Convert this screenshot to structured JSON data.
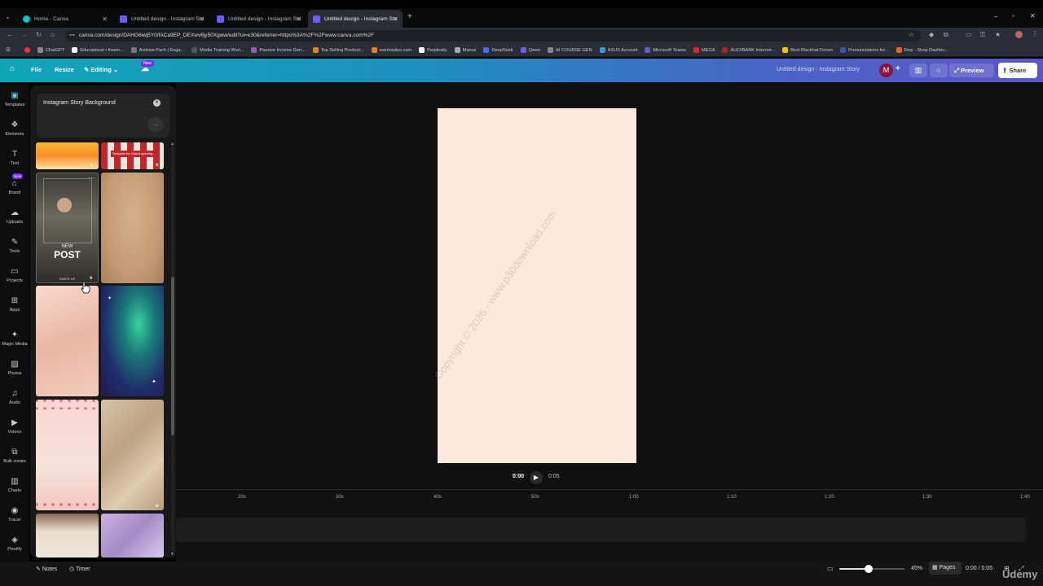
{
  "browser": {
    "tabs": [
      {
        "label": "Home - Canva"
      },
      {
        "label": "Untitled design - Instagram Sto"
      },
      {
        "label": "Untitled design - Instagram Sto"
      },
      {
        "label": "Untitled design - Instagram Sto"
      }
    ],
    "url": "canva.com/design/DAHG6iwj5Y0/fACa9EP_DEXwv6jy50Xgww/edit?ui=e30&referrer=https%3A%2F%2Fwww.canva.com%2F",
    "bookmarks": [
      {
        "label": "ChatGPT",
        "color": "#888888"
      },
      {
        "label": "Educational • freem...",
        "color": "#ffffff"
      },
      {
        "label": "Andrew Pach | Enga...",
        "color": "#777777"
      },
      {
        "label": "Media Training Worl...",
        "color": "#555555"
      },
      {
        "label": "Passive Income Gen...",
        "color": "#9b59b6"
      },
      {
        "label": "Top Selling Product...",
        "color": "#e67e22"
      },
      {
        "label": "warriorplus.com",
        "color": "#e67e22"
      },
      {
        "label": "Perplexity",
        "color": "#ffffff"
      },
      {
        "label": "Manus",
        "color": "#aaaaaa"
      },
      {
        "label": "DeepSeek",
        "color": "#4a6cf7"
      },
      {
        "label": "Qwen",
        "color": "#6c5ce7"
      },
      {
        "label": "AI COURSE GEN",
        "color": "#888888"
      },
      {
        "label": "ASUS Account",
        "color": "#3498db"
      },
      {
        "label": "Microsoft Teams",
        "color": "#5b5fc7"
      },
      {
        "label": "MEGA",
        "color": "#d9272e"
      },
      {
        "label": "ALEXBANK Internet...",
        "color": "#aa2222"
      },
      {
        "label": "Best Blackhat Forum",
        "color": "#f1c40f"
      },
      {
        "label": "Pronunciations for...",
        "color": "#2e5aac"
      },
      {
        "label": "Etsy - Shop Dashbo...",
        "color": "#e8622a"
      }
    ]
  },
  "header": {
    "file": "File",
    "resize": "Resize",
    "editing": "Editing",
    "new_badge": "New",
    "doc_title": "Untitled design - Instagram Story",
    "avatar": "M",
    "preview": "Preview",
    "share": "Share"
  },
  "rail": [
    {
      "label": "Templates",
      "icon": "▣"
    },
    {
      "label": "Elements",
      "icon": "❖"
    },
    {
      "label": "Text",
      "icon": "T"
    },
    {
      "label": "Brand",
      "icon": "⌂",
      "badge": "New"
    },
    {
      "label": "Uploads",
      "icon": "☁"
    },
    {
      "label": "Tools",
      "icon": "✎"
    },
    {
      "label": "Projects",
      "icon": "▭"
    },
    {
      "label": "Apps",
      "icon": "⊞"
    },
    {
      "label": "Magic Media",
      "icon": "✦"
    },
    {
      "label": "Photos",
      "icon": "▨"
    },
    {
      "label": "Audio",
      "icon": "♫"
    },
    {
      "label": "Videos",
      "icon": "▶"
    },
    {
      "label": "Bulk create",
      "icon": "⧉"
    },
    {
      "label": "Charts",
      "icon": "▥"
    },
    {
      "label": "Tracer",
      "icon": "◉"
    },
    {
      "label": "Pixelify",
      "icon": "◈"
    }
  ],
  "search": {
    "value": "Instagram Story Background"
  },
  "templates": {
    "post_new": "NEW",
    "post_title": "POST",
    "post_swipe": "SWIPE UP",
    "banner_text": "Template for Grand opening"
  },
  "watermark": "Copyright © 2026 - www.p30download.com",
  "player": {
    "current": "0:00",
    "total": "0:05"
  },
  "timeline": {
    "ticks": [
      "20s",
      "30s",
      "40s",
      "50s",
      "1:00",
      "1:10",
      "1:20",
      "1:30",
      "1:40"
    ]
  },
  "footer": {
    "notes": "Notes",
    "timer": "Timer",
    "zoom": "45%",
    "zoom_level": 0.45,
    "pages": "Pages",
    "time": "0:00 / 0:05",
    "udemy": "Udemy"
  }
}
